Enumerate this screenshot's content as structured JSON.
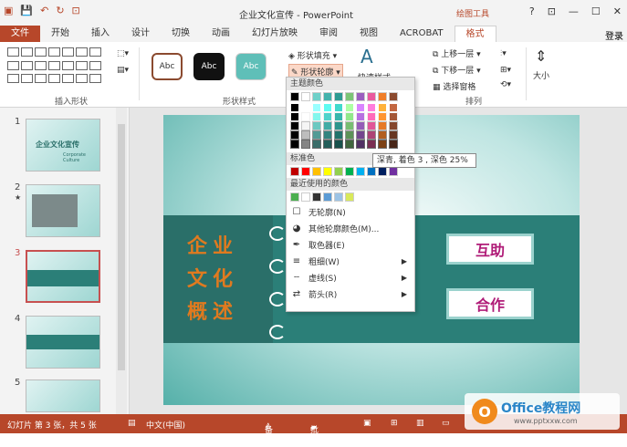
{
  "titlebar": {
    "title": "企业文化宣传 - PowerPoint",
    "context_tools": "绘图工具",
    "help": "?",
    "restore": "⊡",
    "minimize": "—",
    "maximize": "☐",
    "close": "✕"
  },
  "tabs": [
    "文件",
    "开始",
    "插入",
    "设计",
    "切换",
    "动画",
    "幻灯片放映",
    "审阅",
    "视图",
    "ACROBAT",
    "格式"
  ],
  "login": "登录",
  "ribbon": {
    "insert_shapes_label": "插入形状",
    "shape_styles_label": "形状样式",
    "arrange_label": "排列",
    "style_preview": "Abc",
    "shape_fill": "形状填充",
    "shape_outline": "形状轮廓",
    "quick_styles": "快速样式",
    "bring_forward": "上移一层",
    "send_backward": "下移一层",
    "selection_pane": "选择窗格",
    "size": "大小"
  },
  "dropdown": {
    "theme_colors": "主题颜色",
    "standard_colors": "标准色",
    "recent_colors": "最近使用的颜色",
    "no_outline": "无轮廓(N)",
    "more_colors": "其他轮廓颜色(M)...",
    "eyedropper": "取色器(E)",
    "weight": "粗细(W)",
    "dashes": "虚线(S)",
    "arrows": "箭头(R)",
    "theme_top": [
      "#000000",
      "#ffffff",
      "#6fd1c9",
      "#44b3ac",
      "#2f9b92",
      "#7cc576",
      "#9b5fbf",
      "#ea5a9e",
      "#f07f2a",
      "#8b4a2f"
    ],
    "standard": [
      "#c00000",
      "#ff0000",
      "#ffc000",
      "#ffff00",
      "#92d050",
      "#00b050",
      "#00b0f0",
      "#0070c0",
      "#002060",
      "#7030a0"
    ],
    "recent": [
      "#4caf50",
      "#ffffff",
      "#333333",
      "#5b9bd5",
      "#9cc3e5",
      "#d9e95a"
    ]
  },
  "tooltip": "深青, 着色 3 , 深色 25%",
  "slides": {
    "numbers": [
      "1",
      "2",
      "3",
      "4",
      "5"
    ],
    "star": "★",
    "thumb1_text": "企业文化宣传",
    "thumb1_sub": "Corporate Culture"
  },
  "slide": {
    "title_lines": [
      "企业",
      "文化",
      "概述"
    ],
    "box1": "互助",
    "box2": "合作"
  },
  "statusbar": {
    "slide_info": "幻灯片 第 3 张，共 5 张",
    "language": "中文(中国)",
    "notes": "备注",
    "comments": "批注",
    "zoom": "+"
  },
  "watermark": {
    "logo_letter": "O",
    "brand": "Office教程网",
    "url": "www.pptxxw.com"
  },
  "colors": {
    "accent": "#b7472a",
    "slide_teal": "#2b7f78",
    "title_orange": "#e07a1f",
    "box_text": "#b01c78"
  }
}
